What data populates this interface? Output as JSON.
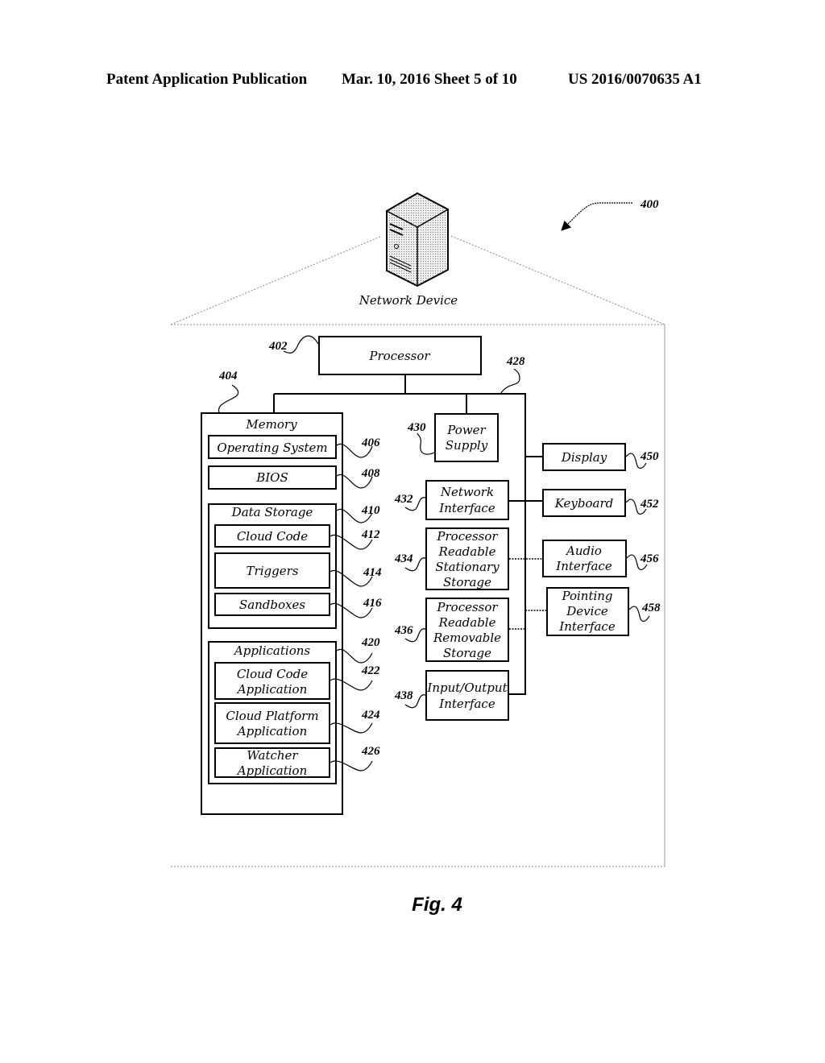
{
  "header": {
    "publication": "Patent Application Publication",
    "date_sheet": "Mar. 10, 2016  Sheet 5 of 10",
    "patent_number": "US 2016/0070635 A1"
  },
  "figure": {
    "ref": "400",
    "device_label": "Network Device",
    "caption": "Fig. 4"
  },
  "processor": {
    "label": "Processor",
    "ref": "402"
  },
  "bus": {
    "ref": "428"
  },
  "memory": {
    "label": "Memory",
    "ref": "404",
    "os": {
      "label": "Operating System",
      "ref": "406"
    },
    "bios": {
      "label": "BIOS",
      "ref": "408"
    },
    "data_storage": {
      "label": "Data Storage",
      "ref": "410",
      "cloud_code": {
        "label": "Cloud Code",
        "ref": "412"
      },
      "triggers": {
        "label": "Triggers",
        "ref": "414"
      },
      "sandboxes": {
        "label": "Sandboxes",
        "ref": "416"
      }
    },
    "applications": {
      "label": "Applications",
      "ref": "420",
      "cloud_code_app": {
        "line1": "Cloud Code",
        "line2": "Application",
        "ref": "422"
      },
      "cloud_platform_app": {
        "line1": "Cloud  Platform",
        "line2": "Application",
        "ref": "424"
      },
      "watcher_app": {
        "line1": "Watcher",
        "line2": "Application",
        "ref": "426"
      }
    }
  },
  "power_supply": {
    "line1": "Power",
    "line2": "Supply",
    "ref": "430"
  },
  "network_interface": {
    "line1": "Network",
    "line2": "Interface",
    "ref": "432"
  },
  "stationary_storage": {
    "line1": "Processor",
    "line2": "Readable",
    "line3": "Stationary",
    "line4": "Storage",
    "ref": "434"
  },
  "removable_storage": {
    "line1": "Processor",
    "line2": "Readable",
    "line3": "Removable",
    "line4": "Storage",
    "ref": "436"
  },
  "io_interface": {
    "line1": "Input/Output",
    "line2": "Interface",
    "ref": "438"
  },
  "display": {
    "label": "Display",
    "ref": "450"
  },
  "keyboard": {
    "label": "Keyboard",
    "ref": "452"
  },
  "audio_interface": {
    "line1": "Audio",
    "line2": "Interface",
    "ref": "456"
  },
  "pointing_device": {
    "line1": "Pointing",
    "line2": "Device",
    "line3": "Interface",
    "ref": "458"
  }
}
